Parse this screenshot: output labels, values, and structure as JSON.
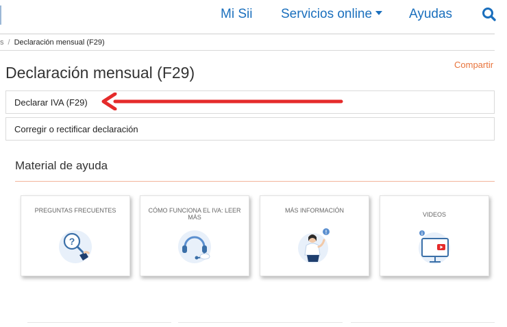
{
  "nav": {
    "links": [
      "Mi Sii",
      "Servicios online",
      "Ayudas"
    ]
  },
  "breadcrumb": {
    "previous": "s",
    "current": "Declaración mensual (F29)"
  },
  "page": {
    "title": "Declaración mensual (F29)",
    "share": "Compartir"
  },
  "options": [
    "Declarar IVA (F29)",
    "Corregir o rectificar declaración"
  ],
  "help": {
    "title": "Material de ayuda",
    "cards": [
      {
        "label": "PREGUNTAS FRECUENTES",
        "icon": "question-magnifier-icon"
      },
      {
        "label": "CÓMO FUNCIONA EL IVA: LEER MÁS",
        "icon": "headset-support-icon"
      },
      {
        "label": "MÁS INFORMACIÓN",
        "icon": "person-info-icon"
      },
      {
        "label": "VIDEOS",
        "icon": "video-monitor-icon"
      }
    ]
  },
  "colors": {
    "nav_link": "#1a6fbd",
    "accent_orange": "#e8733a",
    "arrow_red": "#e52b2b"
  }
}
